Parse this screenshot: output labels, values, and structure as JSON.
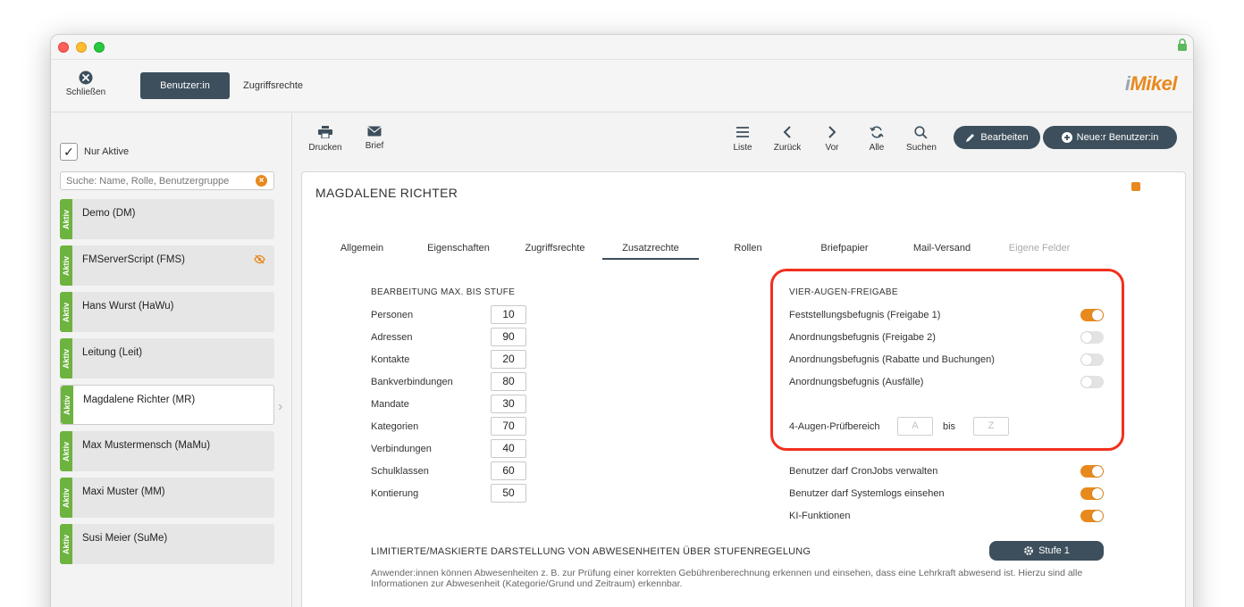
{
  "topbar": {
    "close_label": "Schließen",
    "tab_user": "Benutzer:in",
    "tab_rights": "Zugriffsrechte",
    "logo_prefix": "i",
    "logo_main": "Mikel"
  },
  "sidebar": {
    "only_active_label": "Nur Aktive",
    "only_active_checked": true,
    "search_placeholder": "Suche: Name, Rolle, Benutzergruppe",
    "status_label": "Aktiv",
    "users": [
      {
        "name": "Demo (DM)"
      },
      {
        "name": "FMServerScript (FMS)"
      },
      {
        "name": "Hans Wurst (HaWu)"
      },
      {
        "name": "Leitung (Leit)"
      },
      {
        "name": "Magdalene Richter (MR)"
      },
      {
        "name": "Max Mustermensch (MaMu)"
      },
      {
        "name": "Maxi Muster (MM)"
      },
      {
        "name": "Susi Meier (SuMe)"
      }
    ]
  },
  "toolbar": {
    "print": "Drucken",
    "letter": "Brief",
    "list": "Liste",
    "back": "Zurück",
    "forward": "Vor",
    "all": "Alle",
    "search": "Suchen",
    "edit": "Bearbeiten",
    "new_user": "Neue:r Benutzer:in"
  },
  "record": {
    "title": "MAGDALENE RICHTER",
    "tabs": [
      {
        "label": "Allgemein"
      },
      {
        "label": "Eigenschaften"
      },
      {
        "label": "Zugriffsrechte"
      },
      {
        "label": "Zusatzrechte"
      },
      {
        "label": "Rollen"
      },
      {
        "label": "Briefpapier"
      },
      {
        "label": "Mail-Versand"
      },
      {
        "label": "Eigene Felder"
      }
    ],
    "active_tab": "Zusatzrechte"
  },
  "levels": {
    "header": "BEARBEITUNG MAX. BIS STUFE",
    "rows": [
      {
        "label": "Personen",
        "value": "10"
      },
      {
        "label": "Adressen",
        "value": "90"
      },
      {
        "label": "Kontakte",
        "value": "20"
      },
      {
        "label": "Bankverbindungen",
        "value": "80"
      },
      {
        "label": "Mandate",
        "value": "30"
      },
      {
        "label": "Kategorien",
        "value": "70"
      },
      {
        "label": "Verbindungen",
        "value": "40"
      },
      {
        "label": "Schulklassen",
        "value": "60"
      },
      {
        "label": "Kontierung",
        "value": "50"
      }
    ]
  },
  "four_eyes": {
    "header": "VIER-AUGEN-FREIGABE",
    "rows": [
      {
        "label": "Feststellungsbefugnis (Freigabe 1)",
        "on": true
      },
      {
        "label": "Anordnungsbefugnis (Freigabe 2)",
        "on": false
      },
      {
        "label": "Anordnungsbefugnis (Rabatte und Buchungen)",
        "on": false
      },
      {
        "label": "Anordnungsbefugnis (Ausfälle)",
        "on": false
      }
    ],
    "range_label": "4-Augen-Prüfbereich",
    "range_from": "A",
    "range_sep": "bis",
    "range_to": "Z"
  },
  "other_rights": [
    {
      "label": "Benutzer darf CronJobs verwalten",
      "on": true
    },
    {
      "label": "Benutzer darf Systemlogs einsehen",
      "on": true
    },
    {
      "label": "KI-Funktionen",
      "on": true
    }
  ],
  "absence": {
    "header": "LIMITIERTE/MASKIERTE DARSTELLUNG VON ABWESENHEITEN ÜBER STUFENREGELUNG",
    "button": "Stufe 1",
    "description": "Anwender:innen können Abwesenheiten z. B. zur Prüfung einer korrekten Gebührenberechnung erkennen und einsehen, dass eine Lehrkraft abwesend ist. Hierzu sind alle Informationen zur Abwesenheit (Kategorie/Grund und Zeitraum) erkennbar."
  },
  "colors": {
    "accent": "#e8891d",
    "dark": "#3d4f5c",
    "status_green": "#6db33f",
    "highlight": "#f0301e"
  }
}
